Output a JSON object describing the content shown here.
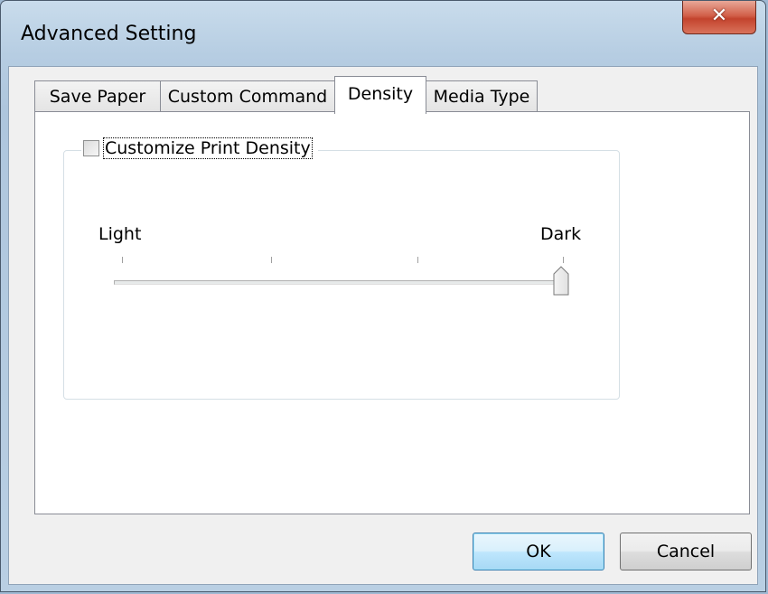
{
  "window": {
    "title": "Advanced Setting",
    "close_icon": "close-icon"
  },
  "tabs": [
    {
      "label": "Save Paper",
      "active": false
    },
    {
      "label": "Custom Command",
      "active": false
    },
    {
      "label": "Density",
      "active": true
    },
    {
      "label": "Media Type",
      "active": false
    }
  ],
  "density": {
    "checkbox_label": "Customize Print Density",
    "checkbox_checked": false,
    "slider": {
      "min_label": "Light",
      "max_label": "Dark",
      "tick_count": 4,
      "value_fraction": 1.0
    }
  },
  "buttons": {
    "ok_label": "OK",
    "cancel_label": "Cancel"
  }
}
